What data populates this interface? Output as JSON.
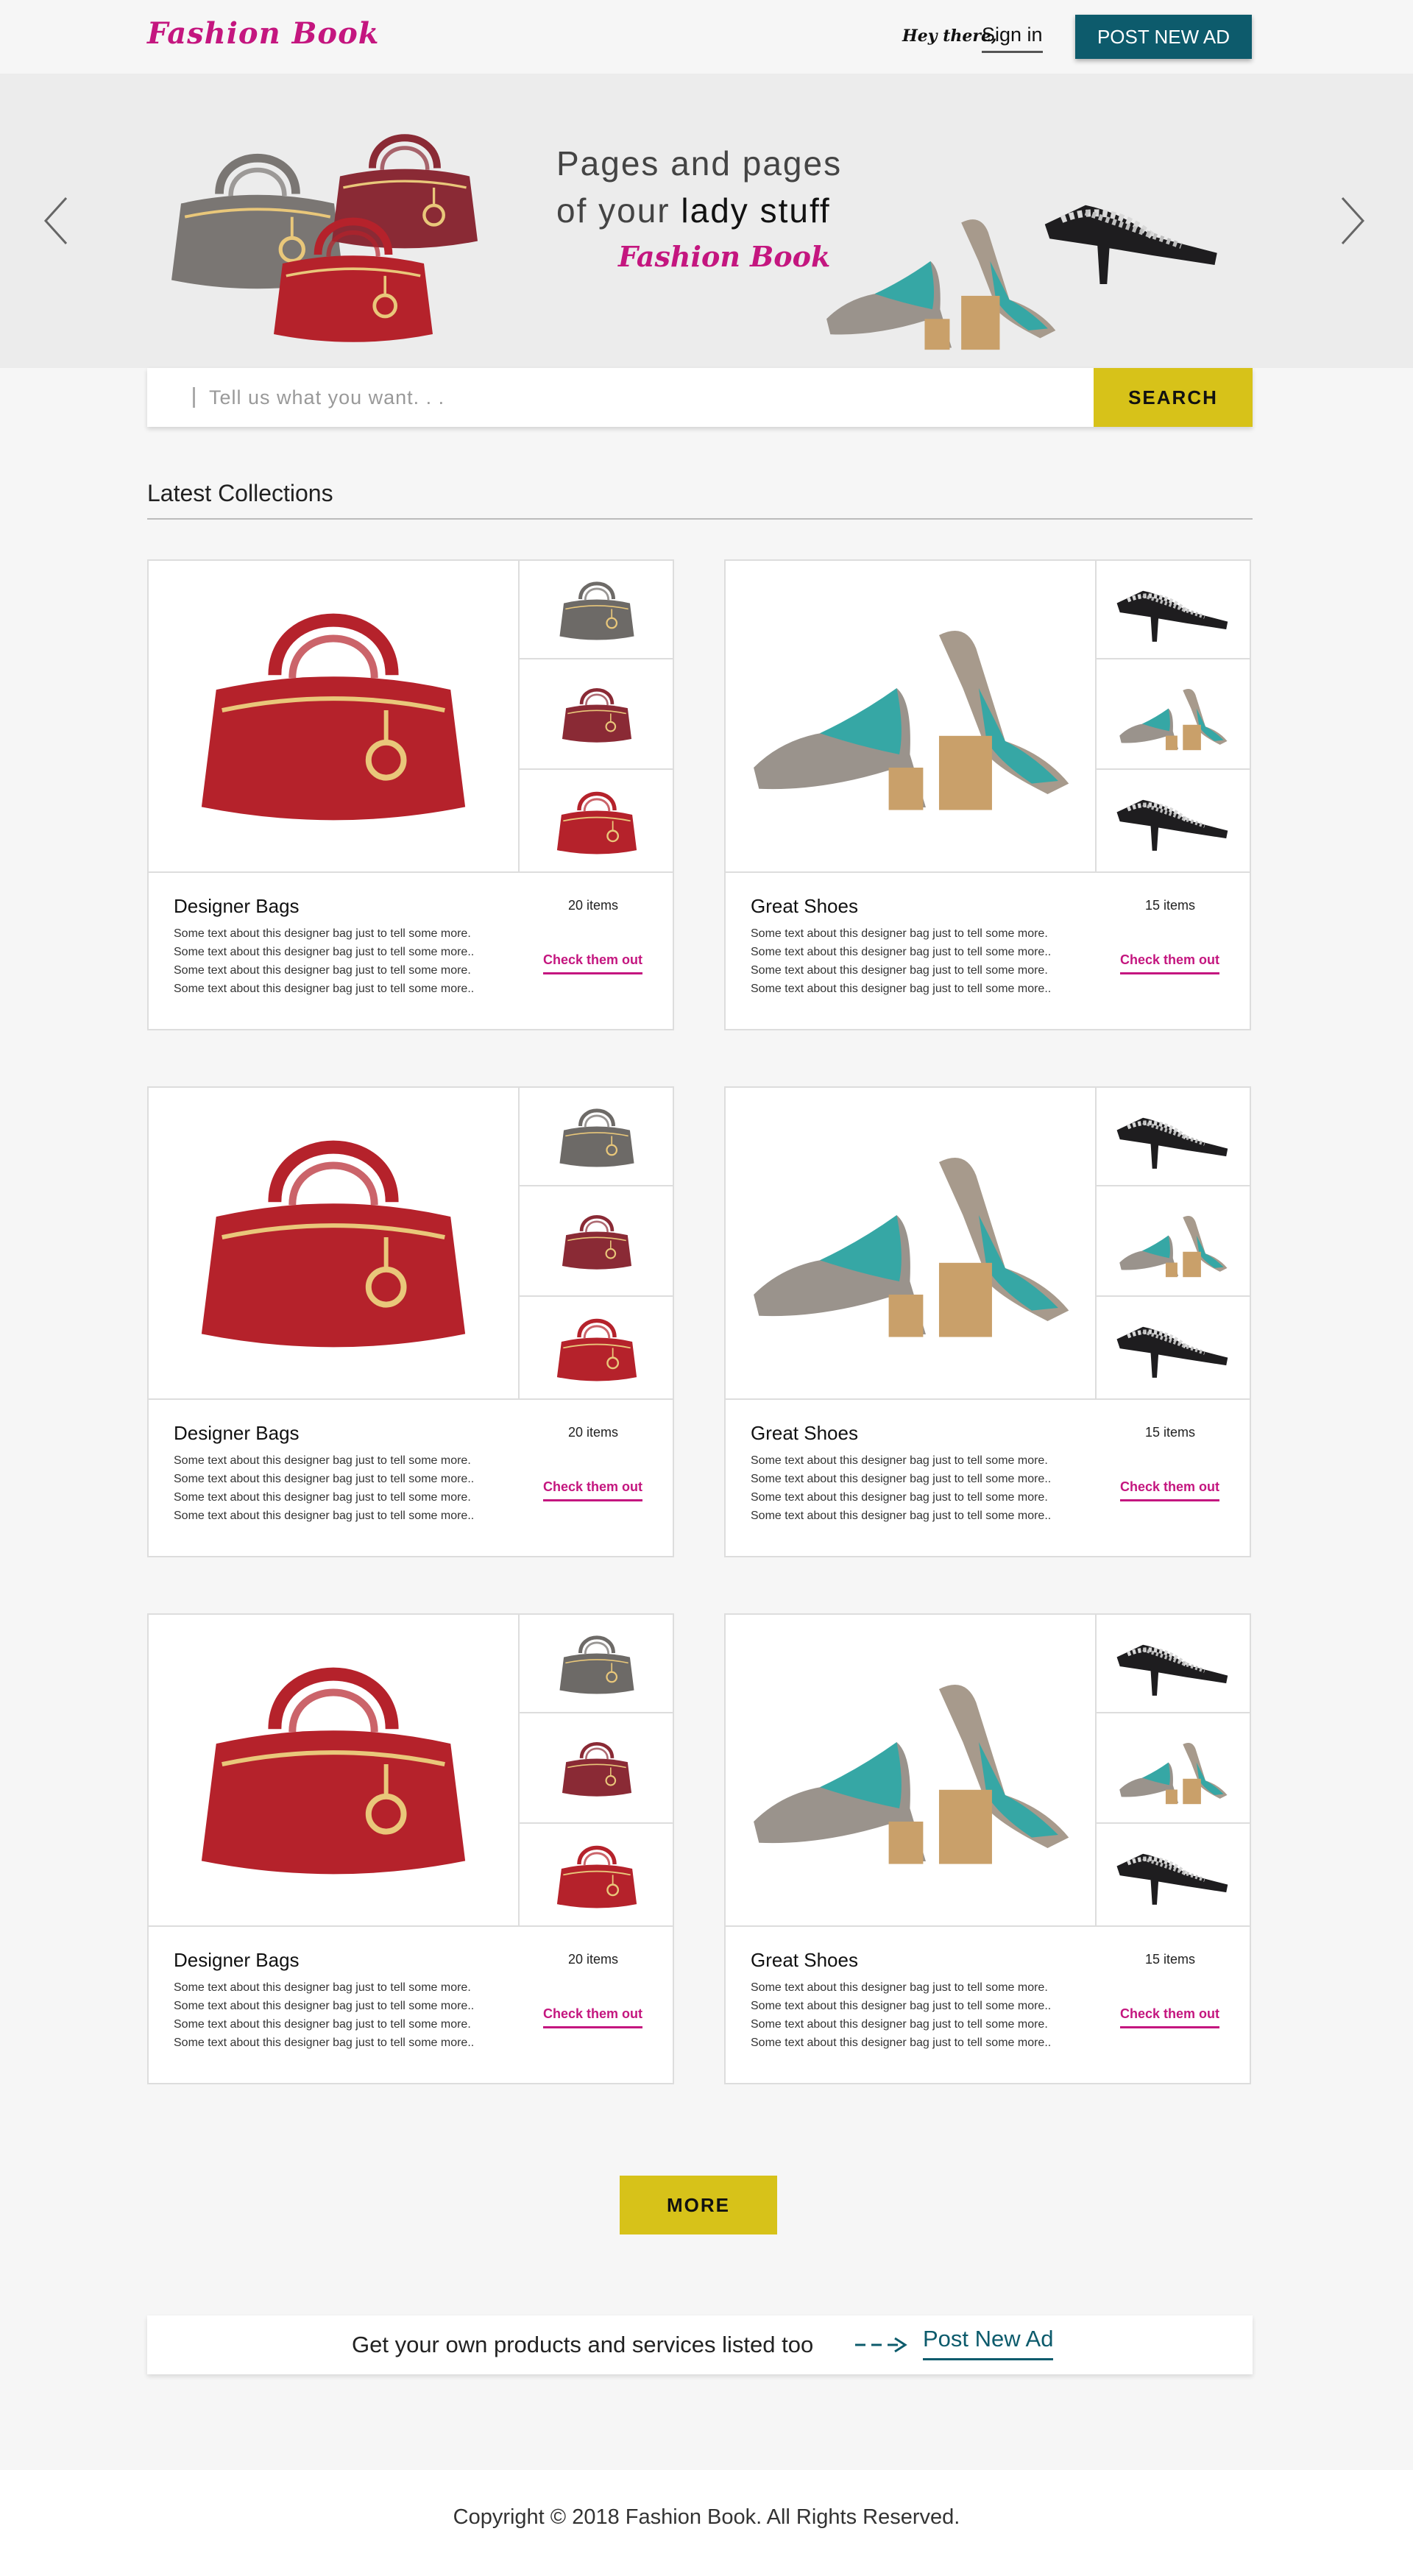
{
  "header": {
    "logo": "Fashion Book",
    "greeting": "Hey there,",
    "sign_in": "Sign in",
    "post_ad": "POST NEW AD"
  },
  "hero": {
    "line1": "Pages and pages",
    "line2_prefix": "of your ",
    "line2_bold": "lady stuff",
    "brand": "Fashion Book"
  },
  "search": {
    "placeholder": "Tell us what you want. . .",
    "button": "SEARCH"
  },
  "section": {
    "title": "Latest Collections"
  },
  "collections": [
    {
      "title": "Designer Bags",
      "count": "20 items",
      "link": "Check them out",
      "description": "Some text about this designer bag just to tell some more. Some text about this designer bag just to tell some more.. Some text about this designer bag just to tell some more. Some text about this designer bag just to tell some more.."
    },
    {
      "title": "Great Shoes",
      "count": "15 items",
      "link": "Check them out",
      "description": "Some text about this designer bag just to tell some more. Some text about this designer bag just to tell some more.. Some text about this designer bag just to tell some more. Some text about this designer bag just to tell some more.."
    },
    {
      "title": "Designer Bags",
      "count": "20 items",
      "link": "Check them out",
      "description": "Some text about this designer bag just to tell some more. Some text about this designer bag just to tell some more.. Some text about this designer bag just to tell some more. Some text about this designer bag just to tell some more.."
    },
    {
      "title": "Great Shoes",
      "count": "15 items",
      "link": "Check them out",
      "description": "Some text about this designer bag just to tell some more. Some text about this designer bag just to tell some more.. Some text about this designer bag just to tell some more. Some text about this designer bag just to tell some more.."
    },
    {
      "title": "Designer Bags",
      "count": "20 items",
      "link": "Check them out",
      "description": "Some text about this designer bag just to tell some more. Some text about this designer bag just to tell some more.. Some text about this designer bag just to tell some more. Some text about this designer bag just to tell some more.."
    },
    {
      "title": "Great Shoes",
      "count": "15 items",
      "link": "Check them out",
      "description": "Some text about this designer bag just to tell some more. Some text about this designer bag just to tell some more.. Some text about this designer bag just to tell some more. Some text about this designer bag just to tell some more.."
    }
  ],
  "more_button": "MORE",
  "promo": {
    "text": "Get your own products and services listed too",
    "link": "Post New Ad"
  },
  "footer": {
    "copyright": "Copyright © 2018 Fashion Book. All Rights Reserved."
  },
  "colors": {
    "brand": "#c4167f",
    "teal": "#0d5b6c",
    "accent_yellow": "#d7c219"
  }
}
